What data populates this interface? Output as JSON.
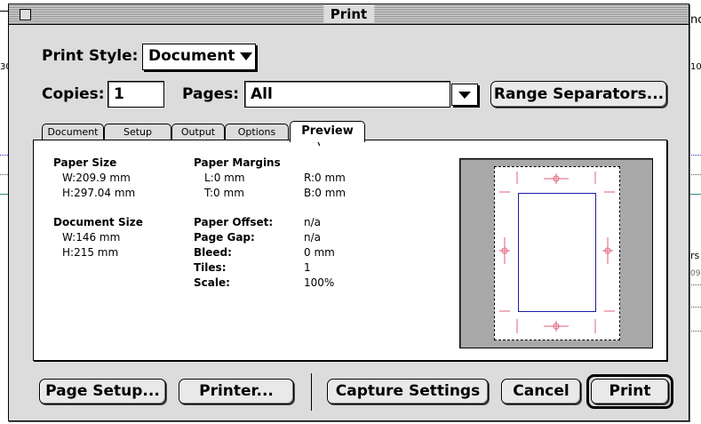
{
  "dialog": {
    "title": "Print"
  },
  "background": {
    "fragments": [
      "30",
      "nc",
      "10",
      "rs",
      "09"
    ]
  },
  "print_style": {
    "label": "Print Style:",
    "value": "Document"
  },
  "copies": {
    "label": "Copies:",
    "value": "1"
  },
  "pages": {
    "label": "Pages:",
    "value": "All"
  },
  "range_separators_label": "Range Separators...",
  "tabs": [
    {
      "label": "Document",
      "active": false
    },
    {
      "label": "Setup",
      "active": false
    },
    {
      "label": "Output",
      "active": false
    },
    {
      "label": "Options",
      "active": false
    },
    {
      "label": "Preview",
      "active": true
    }
  ],
  "preview": {
    "paper_size": {
      "heading": "Paper Size",
      "w": "W:209.9 mm",
      "h": "H:297.04 mm"
    },
    "paper_margins": {
      "heading": "Paper Margins",
      "l": "L:0 mm",
      "r": "R:0 mm",
      "t": "T:0 mm",
      "b": "B:0 mm"
    },
    "document_size": {
      "heading": "Document Size",
      "w": "W:146 mm",
      "h": "H:215 mm"
    },
    "details": [
      {
        "label": "Paper Offset:",
        "value": "n/a"
      },
      {
        "label": "Page Gap:",
        "value": "n/a"
      },
      {
        "label": "Bleed:",
        "value": "0 mm"
      },
      {
        "label": "Tiles:",
        "value": "1"
      },
      {
        "label": "Scale:",
        "value": "100%"
      }
    ]
  },
  "buttons": {
    "page_setup": "Page Setup...",
    "printer": "Printer...",
    "capture_settings": "Capture Settings",
    "cancel": "Cancel",
    "print": "Print"
  },
  "colors": {
    "dialog_bg": "#dcdcdc",
    "page_outline": "#1b1ba8",
    "crop_marks": "#e0607a",
    "preview_bg": "#a8a8a8"
  }
}
